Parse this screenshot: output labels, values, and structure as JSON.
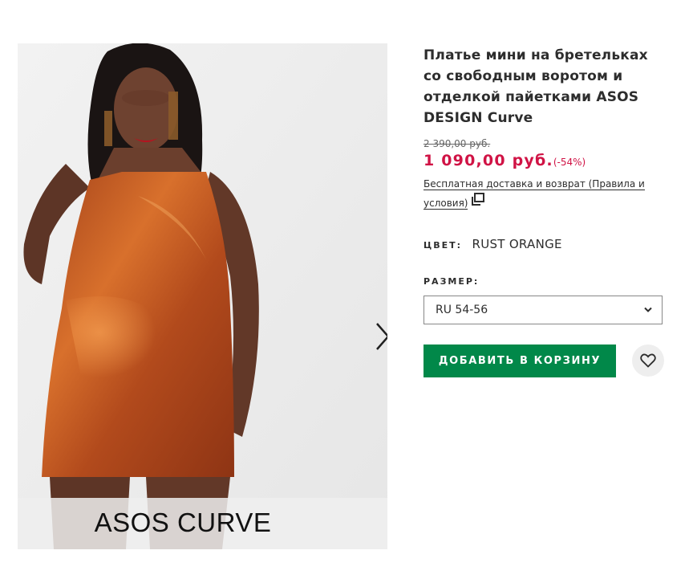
{
  "product": {
    "title": "Платье мини на бретельках со свободным воротом и отделкой пайетками ASOS DESIGN Curve",
    "old_price": "2 390,00 руб.",
    "price": "1 090,00 руб.",
    "discount": "(-54%)",
    "delivery_text": "Бесплатная доставка и возврат (Правила и условия)",
    "color_label": "ЦВЕТ:",
    "color_value": "RUST ORANGE",
    "size_label": "РАЗМЕР:",
    "size_selected": "RU 54-56",
    "add_to_bag_label": "ДОБАВИТЬ В КОРЗИНУ"
  },
  "gallery": {
    "banner_text": "ASOS CURVE"
  },
  "colors": {
    "price": "#d01345",
    "add_button": "#018849",
    "dress": "#c0561f"
  },
  "icons": {
    "next": "chevron-right-icon",
    "popup": "popup-window-icon",
    "dropdown": "chevron-down-icon",
    "wishlist": "heart-icon"
  }
}
